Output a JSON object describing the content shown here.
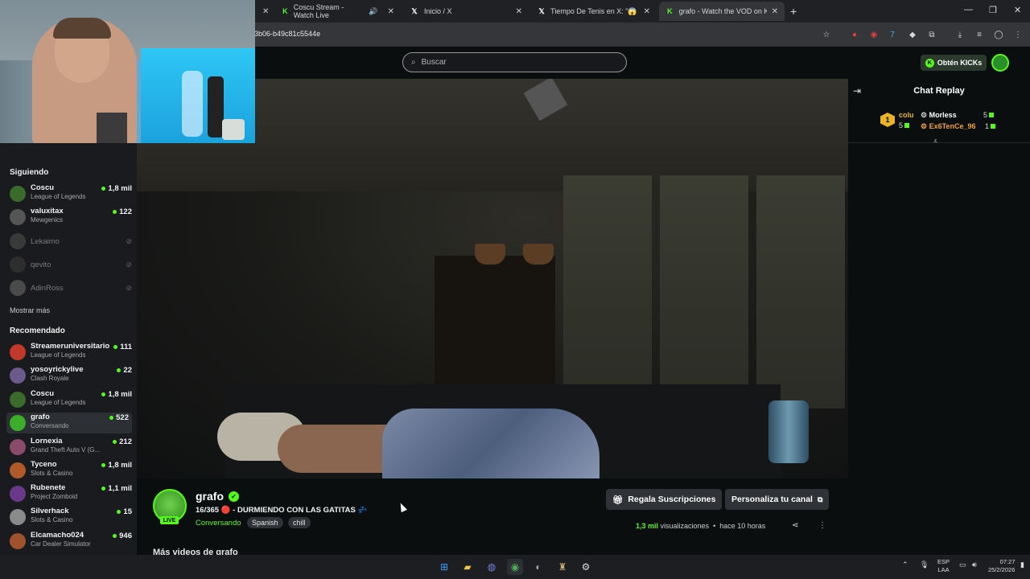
{
  "browser": {
    "tabs": [
      {
        "title": "Coscu Stream - Watch Live",
        "icon": "kick-icon"
      },
      {
        "title": "Inicio / X",
        "icon": "x-icon"
      },
      {
        "title": "Tiempo De Tenis en X: \"😱 EL E",
        "icon": "x-icon"
      },
      {
        "title": "grafo - Watch the VOD on Kick",
        "icon": "kick-icon"
      }
    ],
    "url": "3b06-b49c81c5544e"
  },
  "header": {
    "search_placeholder": "Buscar",
    "get_kicks_label": "Obtén KICKs"
  },
  "sidebar": {
    "following_title": "Siguiendo",
    "following": [
      {
        "name": "Coscu",
        "game": "League of Legends",
        "viewers": "1,8 mil",
        "avatar_color": "#3b6b2a"
      },
      {
        "name": "valuxitax",
        "game": "Mewgenics",
        "viewers": "122",
        "avatar_color": "#555555"
      }
    ],
    "offline": [
      {
        "name": "Lekaimo",
        "avatar_color": "#3a3a3a"
      },
      {
        "name": "qevito",
        "avatar_color": "#2e2e2e"
      },
      {
        "name": "AdinRoss",
        "avatar_color": "#4a4a4a"
      }
    ],
    "show_more": "Mostrar más",
    "recommended_title": "Recomendado",
    "recommended": [
      {
        "name": "Streameruniversitario",
        "game": "League of Legends",
        "viewers": "111",
        "avatar_color": "#c0392b"
      },
      {
        "name": "yosoyrickylive",
        "game": "Clash Royale",
        "viewers": "22",
        "avatar_color": "#6b5a8a"
      },
      {
        "name": "Coscu",
        "game": "League of Legends",
        "viewers": "1,8 mil",
        "avatar_color": "#3b6b2a"
      },
      {
        "name": "grafo",
        "game": "Conversando",
        "viewers": "522",
        "avatar_color": "#3cae2a"
      },
      {
        "name": "Lornexia",
        "game": "Grand Theft Auto V (G...",
        "viewers": "212",
        "avatar_color": "#8a4a6a"
      },
      {
        "name": "Tyceno",
        "game": "Slots & Casino",
        "viewers": "1,8 mil",
        "avatar_color": "#b05a2a"
      },
      {
        "name": "Rubenete",
        "game": "Project Zomboid",
        "viewers": "1,1 mil",
        "avatar_color": "#6a3a8a"
      },
      {
        "name": "Silverhack",
        "game": "Slots & Casino",
        "viewers": "15",
        "avatar_color": "#8a8a8a"
      },
      {
        "name": "Elcamacho024",
        "game": "Car Dealer Simulator",
        "viewers": "946",
        "avatar_color": "#a0522d"
      }
    ]
  },
  "chat": {
    "title": "Chat Replay",
    "leaderboard": {
      "rank": "1",
      "top_name": "colu",
      "top_count": "5",
      "entries": [
        {
          "name": "Morless",
          "count": "5"
        },
        {
          "name": "Ex6TenCe_96",
          "count": "1"
        }
      ]
    }
  },
  "stream": {
    "channel": "grafo",
    "live_badge": "LIVE",
    "title": "16/365 🔴 - DURMIENDO CON LAS GATITAS 💤",
    "category": "Conversando",
    "tags": [
      "Spanish",
      "chill"
    ],
    "gift_button": "Regala Suscripciones",
    "customize_button": "Personaliza tu canal",
    "views": "1,3 mil",
    "views_label": "visualizaciones",
    "time_ago": "hace 10 horas",
    "more_videos": "Más videos de grafo"
  },
  "taskbar": {
    "lang_top": "ESP",
    "lang_bottom": "LAA",
    "time": "07:27",
    "date": "25/2/2026"
  },
  "colors": {
    "kick_green": "#53fc18",
    "background": "#0b0e0f",
    "sidebar": "#191b1f"
  }
}
